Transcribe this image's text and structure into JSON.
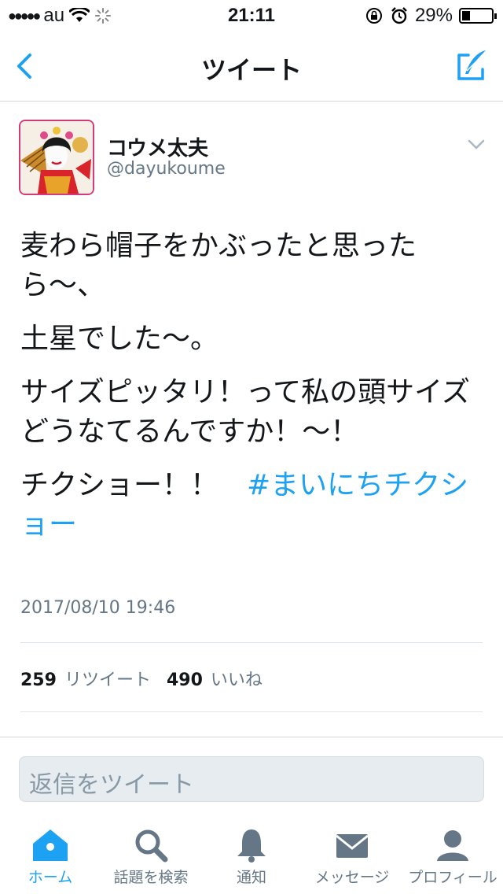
{
  "status_bar": {
    "carrier": "au",
    "time": "21:11",
    "battery": "29%",
    "battery_fill": 0.29
  },
  "nav": {
    "title": "ツイート"
  },
  "tweet": {
    "name": "コウメ太夫",
    "handle": "@dayukoume",
    "lines": [
      "麦わら帽子をかぶったと思ったら〜、",
      "土星でした〜。",
      "サイズピッタリ！って私の頭サイズどうなてるんですか！〜！"
    ],
    "last_line_text": "チクショー！！　",
    "hashtag": "#まいにちチクショー",
    "timestamp": "2017/08/10 19:46",
    "retweet_count": "259",
    "retweet_label": "リツイート",
    "like_count": "490",
    "like_label": "いいね"
  },
  "reply": {
    "placeholder": "返信をツイート"
  },
  "tabs": [
    {
      "label": "ホーム",
      "icon": "home-icon",
      "active": true
    },
    {
      "label": "話題を検索",
      "icon": "search-icon",
      "active": false
    },
    {
      "label": "通知",
      "icon": "bell-icon",
      "active": false
    },
    {
      "label": "メッセージ",
      "icon": "envelope-icon",
      "active": false
    },
    {
      "label": "プロフィール",
      "icon": "person-icon",
      "active": false
    }
  ],
  "colors": {
    "accent": "#1da1f2",
    "muted": "#657786",
    "avatar_border": "#d23c7c"
  }
}
